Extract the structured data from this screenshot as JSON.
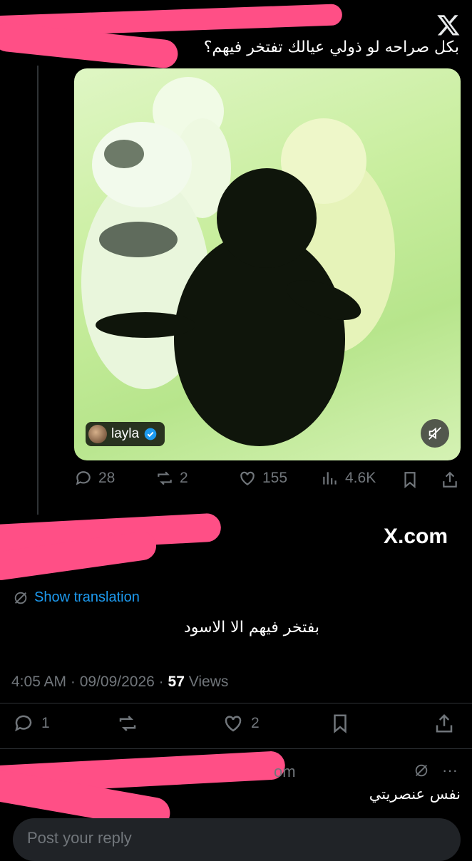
{
  "tweet": {
    "text": "بكل صراحه لو ذولي عيالك تفتخر فيهم؟",
    "media_user": "layla",
    "stats": {
      "replies": "28",
      "reposts": "2",
      "likes": "155",
      "views": "4.6K"
    }
  },
  "header": {
    "domain": "X.com"
  },
  "reply": {
    "translation_label": "Show translation",
    "text": "بفتخر فيهم الا الاسود",
    "time": "4:05 AM",
    "date": "09/09/2026",
    "views_count": "57",
    "views_label": "Views",
    "replies": "1",
    "likes": "2"
  },
  "next_reply": {
    "partial_handle": "om",
    "text": "نفس عنصريتي"
  },
  "composer": {
    "placeholder": "Post your reply"
  },
  "colors": {
    "background": "#000000",
    "accent": "#1d9bf0",
    "muted": "#71767b",
    "redaction": "#ff4f86"
  }
}
